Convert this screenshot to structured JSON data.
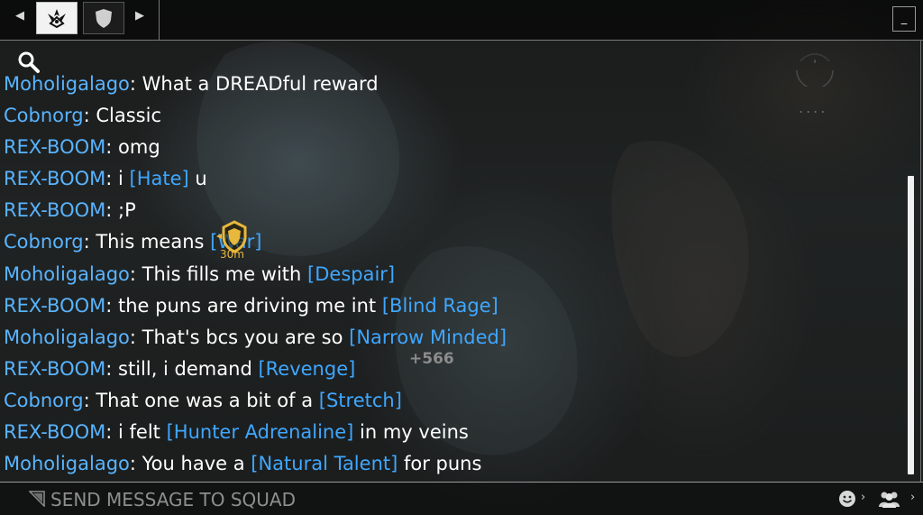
{
  "tabs": [
    {
      "name": "clan-emblem-tab",
      "icon": "lotus-emblem-icon",
      "active": true
    },
    {
      "name": "shield-tab",
      "icon": "shield-icon",
      "active": false
    }
  ],
  "topbar": {
    "prev_icon": "triangle-left-icon",
    "next_icon": "triangle-right-icon",
    "minimize_label": "_"
  },
  "chat": {
    "search_icon": "search-icon",
    "messages": [
      {
        "author": "Moholigalago",
        "parts": [
          {
            "t": "What a DREADful reward"
          }
        ]
      },
      {
        "author": "Cobnorg",
        "parts": [
          {
            "t": "Classic"
          }
        ]
      },
      {
        "author": "REX-BOOM",
        "parts": [
          {
            "t": "omg"
          }
        ]
      },
      {
        "author": "REX-BOOM",
        "parts": [
          {
            "t": "i "
          },
          {
            "tag": "[Hate]"
          },
          {
            "t": " u"
          }
        ]
      },
      {
        "author": "REX-BOOM",
        "parts": [
          {
            "t": ";P"
          }
        ]
      },
      {
        "author": "Cobnorg",
        "parts": [
          {
            "t": "This means "
          },
          {
            "tag": "[War]"
          }
        ]
      },
      {
        "author": "Moholigalago",
        "parts": [
          {
            "t": "This fills me with "
          },
          {
            "tag": "[Despair]"
          }
        ]
      },
      {
        "author": "REX-BOOM",
        "parts": [
          {
            "t": "the puns are driving me int "
          },
          {
            "tag": "[Blind Rage]"
          }
        ]
      },
      {
        "author": "Moholigalago",
        "parts": [
          {
            "t": "That's bcs you are so "
          },
          {
            "tag": "[Narrow Minded]"
          }
        ]
      },
      {
        "author": "REX-BOOM",
        "parts": [
          {
            "t": "still, i demand "
          },
          {
            "tag": "[Revenge]"
          }
        ]
      },
      {
        "author": "Cobnorg",
        "parts": [
          {
            "t": "That one was a bit of a "
          },
          {
            "tag": "[Stretch]"
          }
        ]
      },
      {
        "author": "REX-BOOM",
        "parts": [
          {
            "t": "i felt "
          },
          {
            "tag": "[Hunter Adrenaline]"
          },
          {
            "t": " in my veins"
          }
        ]
      },
      {
        "author": "Moholigalago",
        "parts": [
          {
            "t": "You have a "
          },
          {
            "tag": "[Natural Talent]"
          },
          {
            "t": " for puns"
          }
        ]
      }
    ],
    "author_separator": ": ",
    "colors": {
      "author": "#59b4ff",
      "tag": "#3fa7ff",
      "text": "#ffffff"
    }
  },
  "overlay": {
    "marker_icon": "shield-waypoint-icon",
    "marker_distance": "30m",
    "score_popup": "+566"
  },
  "composer": {
    "send_icon": "send-triangle-icon",
    "placeholder": "SEND MESSAGE TO SQUAD",
    "emoji_icon": "smiley-icon",
    "people_icon": "squad-people-icon"
  }
}
